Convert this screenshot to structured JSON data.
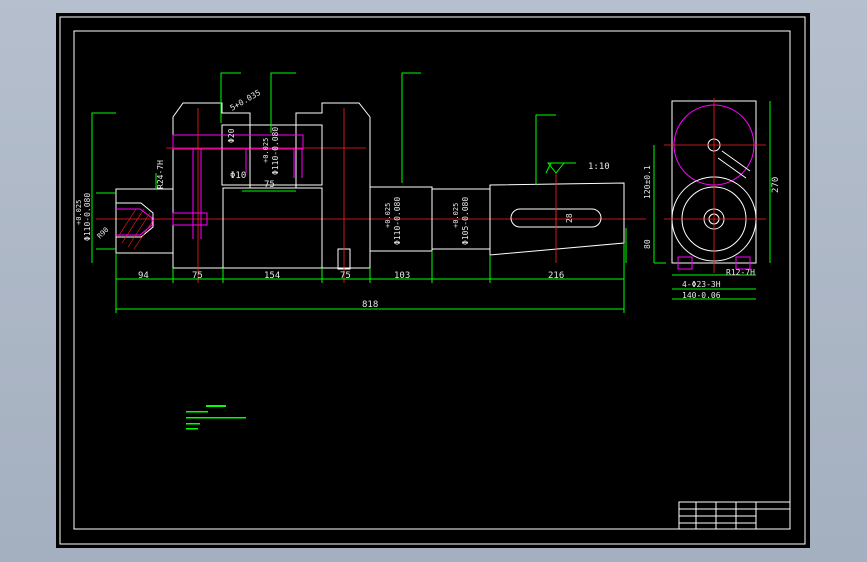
{
  "drawing": {
    "colors": {
      "background": "#000000",
      "outline": "#ffffff",
      "dimension": "#00ff00",
      "hidden": "#ff00ff",
      "centerline": "#ff2020"
    },
    "dims": {
      "d94": "94",
      "d75a": "75",
      "d154": "154",
      "d75b": "75",
      "d103": "103",
      "d216": "216",
      "total": "818",
      "top75": "75",
      "phi110_left": "Φ110-0.080",
      "phi110_left_tol": "+0.025",
      "r24": "R24-7H",
      "phi20": "Φ20",
      "phi10": "Φ10",
      "phi110_top": "Φ110-0.080",
      "phi110_top_tol": "+0.025",
      "phi110_mid": "Φ110-0.080",
      "phi110_mid_tol": "+0.025",
      "phi105": "Φ105-0.080",
      "phi105_tol": "+0.025",
      "key28": "28",
      "taper": "1:10",
      "r90": "R90",
      "top_label": "5+0.035"
    },
    "side_dims": {
      "h120": "120±0.1",
      "h270": "270",
      "h80": "80",
      "r12": "R12-7H",
      "holes": "4-Φ23-3H",
      "w140": "140-0.06"
    }
  }
}
